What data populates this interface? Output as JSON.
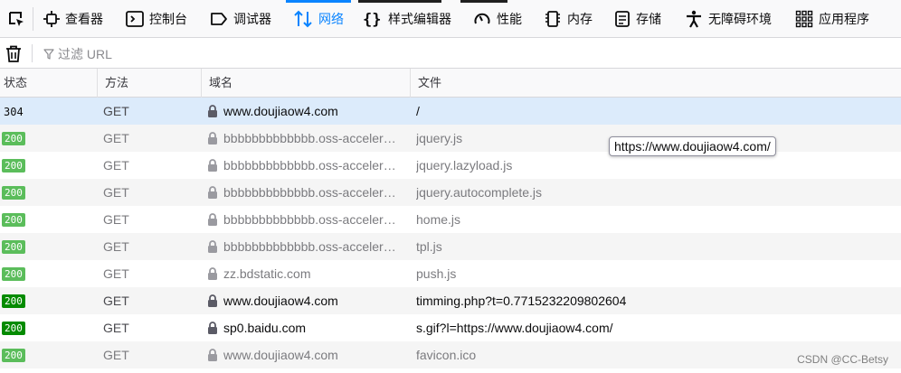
{
  "toolbar": {
    "picker_icon": "element-picker-icon",
    "tabs": [
      {
        "label": "查看器",
        "icon": "inspector-icon"
      },
      {
        "label": "控制台",
        "icon": "console-icon"
      },
      {
        "label": "调试器",
        "icon": "debugger-icon"
      },
      {
        "label": "网络",
        "icon": "network-icon",
        "active": true
      },
      {
        "label": "样式编辑器",
        "icon": "style-editor-icon"
      },
      {
        "label": "性能",
        "icon": "performance-icon"
      },
      {
        "label": "内存",
        "icon": "memory-icon"
      },
      {
        "label": "存储",
        "icon": "storage-icon"
      },
      {
        "label": "无障碍环境",
        "icon": "accessibility-icon"
      },
      {
        "label": "应用程序",
        "icon": "application-icon"
      }
    ],
    "accent_color": "#0a84ff"
  },
  "filter": {
    "placeholder": "过滤 URL",
    "clear_icon": "trash-icon",
    "filter_icon": "funnel-icon"
  },
  "columns": {
    "status": "状态",
    "method": "方法",
    "domain": "域名",
    "file": "文件"
  },
  "requests": [
    {
      "status": "304",
      "method": "GET",
      "domain": "www.doujiaow4.com",
      "file": "/",
      "selected": true
    },
    {
      "status": "200",
      "method": "GET",
      "domain": "bbbbbbbbbbbbb.oss-acceler…",
      "file": "jquery.js",
      "cached": true
    },
    {
      "status": "200",
      "method": "GET",
      "domain": "bbbbbbbbbbbbb.oss-acceler…",
      "file": "jquery.lazyload.js",
      "cached": true
    },
    {
      "status": "200",
      "method": "GET",
      "domain": "bbbbbbbbbbbbb.oss-acceler…",
      "file": "jquery.autocomplete.js",
      "cached": true
    },
    {
      "status": "200",
      "method": "GET",
      "domain": "bbbbbbbbbbbbb.oss-acceler…",
      "file": "home.js",
      "cached": true
    },
    {
      "status": "200",
      "method": "GET",
      "domain": "bbbbbbbbbbbbb.oss-acceler…",
      "file": "tpl.js",
      "cached": true
    },
    {
      "status": "200",
      "method": "GET",
      "domain": "zz.bdstatic.com",
      "file": "push.js",
      "cached": true
    },
    {
      "status": "200",
      "method": "GET",
      "domain": "www.doujiaow4.com",
      "file": "timming.php?t=0.7715232209802604",
      "cached": false
    },
    {
      "status": "200",
      "method": "GET",
      "domain": "sp0.baidu.com",
      "file": "s.gif?l=https://www.doujiaow4.com/",
      "cached": false
    },
    {
      "status": "200",
      "method": "GET",
      "domain": "www.doujiaow4.com",
      "file": "favicon.ico",
      "cached": true
    }
  ],
  "tooltip": "https://www.doujiaow4.com/",
  "watermark": "CSDN @CC-Betsy",
  "colors": {
    "status_fresh": "#058b00",
    "status_cached": "#5bbd5b",
    "selected_row": "#dcebfb"
  }
}
